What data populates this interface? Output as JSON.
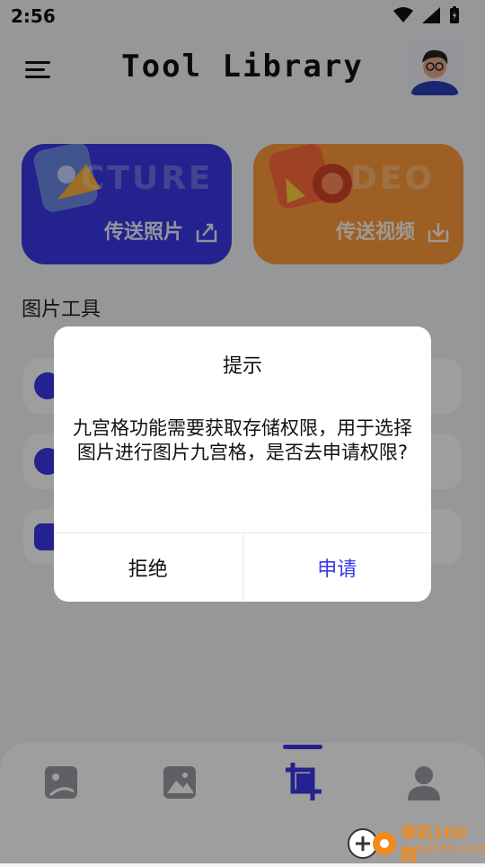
{
  "status_bar": {
    "time": "2:56"
  },
  "header": {
    "title": "Tool Library"
  },
  "cards": [
    {
      "big_word": "CTURE",
      "label": "传送照片",
      "color": "#3a37e6",
      "icon": "upload-icon"
    },
    {
      "big_word": "DEO",
      "label": "传送视频",
      "color": "#ff9a3a",
      "icon": "download-icon"
    }
  ],
  "section": {
    "title": "图片工具"
  },
  "nav": {
    "items": [
      {
        "icon": "photo-edit-icon"
      },
      {
        "icon": "image-icon"
      },
      {
        "icon": "crop-icon",
        "active": true
      },
      {
        "icon": "user-icon"
      }
    ]
  },
  "dialog": {
    "title": "提示",
    "message": "九宫格功能需要获取存储权限，用于选择图片进行图片九宫格，是否去申请权限?",
    "deny_label": "拒绝",
    "apply_label": "申请"
  },
  "watermark": {
    "name": "单机100网",
    "url": "danji100.com"
  },
  "colors": {
    "accent": "#3a37e6",
    "orange": "#ff9a3a"
  }
}
